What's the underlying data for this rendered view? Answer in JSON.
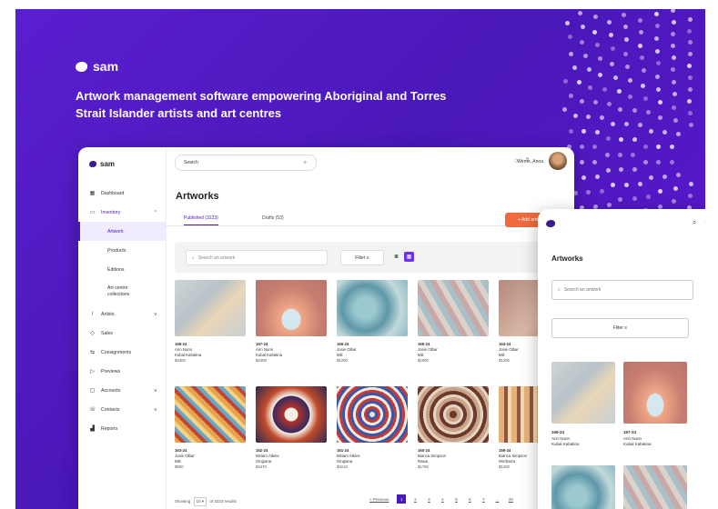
{
  "hero": {
    "brand": "sam",
    "tagline": "Artwork management software empowering Aboriginal and Torres Strait Islander artists and art centres"
  },
  "app": {
    "brand": "sam",
    "search_placeholder": "Search",
    "user_name": "Werne, Anna",
    "page_title": "Artworks",
    "tabs": [
      {
        "label": "Published (3223)",
        "active": true
      },
      {
        "label": "Drafts (53)",
        "active": false
      }
    ],
    "add_button": "+ Add artwork",
    "search_artwork_placeholder": "Search an artwork",
    "filter_label": "Filter"
  },
  "sidebar": {
    "items": [
      {
        "label": "Dashboard",
        "icon": "grid-icon"
      },
      {
        "label": "Inventory",
        "icon": "box-icon"
      },
      {
        "label": "Artwork"
      },
      {
        "label": "Products"
      },
      {
        "label": "Editions"
      },
      {
        "label": "Art centre collections"
      },
      {
        "label": "Artists",
        "icon": "brush-icon"
      },
      {
        "label": "Sales",
        "icon": "tag-icon"
      },
      {
        "label": "Consignments",
        "icon": "arrows-icon"
      },
      {
        "label": "Previews",
        "icon": "play-icon"
      },
      {
        "label": "Accounts",
        "icon": "wallet-icon"
      },
      {
        "label": "Contacts",
        "icon": "phone-icon"
      },
      {
        "label": "Reports",
        "icon": "chart-icon"
      }
    ]
  },
  "artworks": [
    {
      "code": "168-24",
      "artist": "Ann Nunn",
      "place": "Kubal Kabatina",
      "price": "$2300"
    },
    {
      "code": "167-24",
      "artist": "Ann Nunn",
      "place": "Kubal Kabatina",
      "price": "$2400"
    },
    {
      "code": "166-24",
      "artist": "Josie Olbar",
      "place": "Mili",
      "price": "$1200"
    },
    {
      "code": "165-24",
      "artist": "Josie Olbar",
      "place": "Mili",
      "price": "$1000"
    },
    {
      "code": "164-24",
      "artist": "Josie Olbar",
      "place": "Mili",
      "price": "$1200"
    },
    {
      "code": "163-24",
      "artist": "Josie Olbar",
      "place": "Mili",
      "price": "$900"
    },
    {
      "code": "162-24",
      "artist": "Miriam Atkins",
      "place": "Gingiana",
      "price": "$3470"
    },
    {
      "code": "161-24",
      "artist": "Miriam Atkins",
      "place": "Gingiana",
      "price": "$4210"
    },
    {
      "code": "160-24",
      "artist": "Bianca Simpson",
      "place": "Rawa",
      "price": "$1790"
    },
    {
      "code": "159-24",
      "artist": "Bianca Simpson",
      "place": "Wirrbarra",
      "price": "$1200"
    }
  ],
  "pagination": {
    "showing": "Showing",
    "per_page": "10",
    "of_results": "of 3223 results",
    "previous": "< Previous",
    "pages": [
      "1",
      "2",
      "3",
      "4",
      "5",
      "6",
      "7",
      "...",
      "20"
    ]
  },
  "mobile": {
    "title": "Artworks",
    "search_placeholder": "Search an artwork",
    "filter_label": "Filter",
    "artworks": [
      {
        "code": "168-24",
        "artist": "Ann Nunn",
        "place": "Kubal Kabatina"
      },
      {
        "code": "167-24",
        "artist": "Ann Nunn",
        "place": "Kubal Kabatina"
      }
    ]
  },
  "colors": {
    "brand_purple": "#4a17b8",
    "accent_orange": "#f06a3d"
  }
}
